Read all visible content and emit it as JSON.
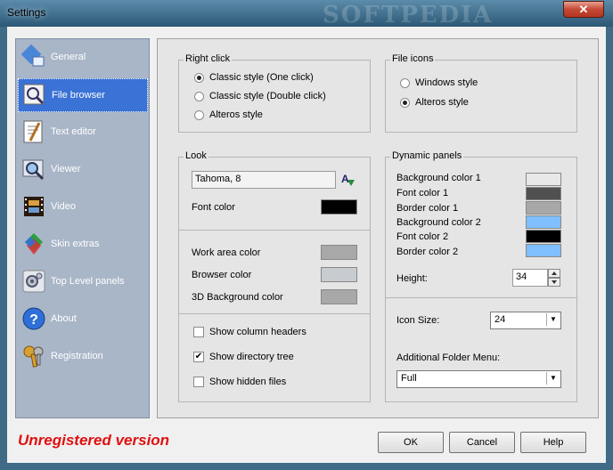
{
  "window": {
    "title": "Settings",
    "watermark": "SOFTPEDIA",
    "close_glyph": "✕"
  },
  "sidebar": {
    "items": [
      {
        "label": "General",
        "icon": "general-icon"
      },
      {
        "label": "File browser",
        "icon": "file-browser-icon",
        "selected": true
      },
      {
        "label": "Text editor",
        "icon": "text-editor-icon"
      },
      {
        "label": "Viewer",
        "icon": "viewer-icon"
      },
      {
        "label": "Video",
        "icon": "video-icon"
      },
      {
        "label": "Skin extras",
        "icon": "skin-extras-icon"
      },
      {
        "label": "Top Level panels",
        "icon": "top-level-panels-icon"
      },
      {
        "label": "About",
        "icon": "about-icon"
      },
      {
        "label": "Registration",
        "icon": "registration-icon"
      }
    ]
  },
  "right_click": {
    "title": "Right click",
    "options": [
      "Classic style (One click)",
      "Classic style (Double click)",
      "Alteros style"
    ],
    "selected": 0
  },
  "file_icons": {
    "title": "File icons",
    "options": [
      "Windows style",
      "Alteros style"
    ],
    "selected": 1
  },
  "look": {
    "title": "Look",
    "font_value": "Tahoma, 8",
    "font_color_label": "Font color",
    "work_area_color_label": "Work area color",
    "browser_color_label": "Browser color",
    "bg3d_color_label": "3D Background color",
    "show_column_headers": "Show column headers",
    "show_directory_tree": "Show directory tree",
    "show_hidden_files": "Show hidden files",
    "column_headers_checked": false,
    "directory_tree_checked": true,
    "hidden_files_checked": false,
    "check_glyph": "✔"
  },
  "dynamic_panels": {
    "title": "Dynamic panels",
    "colors": [
      {
        "label": "Background color 1",
        "value": "#e8e8e8"
      },
      {
        "label": "Font color 1",
        "value": "#505050"
      },
      {
        "label": "Border color 1",
        "value": "#a8a8a8"
      },
      {
        "label": "Background color 2",
        "value": "#7fbfff"
      },
      {
        "label": "Font color 2",
        "value": "#000000"
      },
      {
        "label": "Border color 2",
        "value": "#7fbfff"
      }
    ],
    "height_label": "Height:",
    "height_value": "34",
    "icon_size_label": "Icon Size:",
    "icon_size_value": "24",
    "folder_menu_label": "Additional Folder Menu:",
    "folder_menu_value": "Full"
  },
  "colors": {
    "font_color": "#000000",
    "work_area": "#a8a8a8",
    "browser": "#c8cbd0",
    "bg3d": "#a8a8a8"
  },
  "footer": {
    "unregistered": "Unregistered version",
    "ok": "OK",
    "cancel": "Cancel",
    "help": "Help"
  }
}
